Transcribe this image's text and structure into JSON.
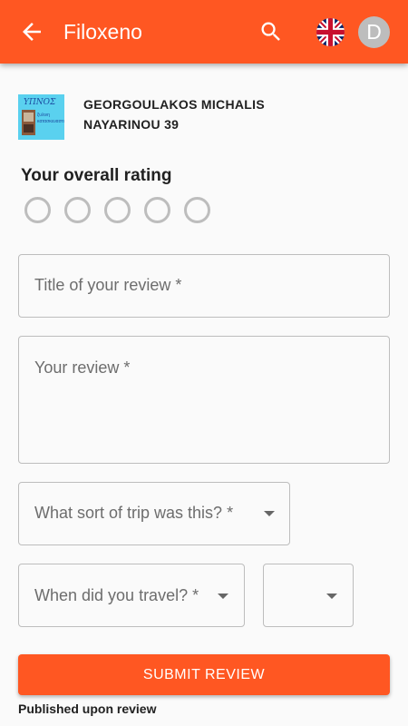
{
  "appbar": {
    "title": "Filoxeno",
    "back_icon": "arrow-back-icon",
    "search_icon": "search-icon",
    "language_icon": "uk-flag-icon",
    "avatar_initial": "D",
    "background_color": "#ff5722"
  },
  "hotel": {
    "logo_text": "ΥΠΝΟΣ",
    "logo_subtext": "ξυλινη κατασκευαστικη",
    "name": "GEORGOULAKOS MICHALIS",
    "address": "NAYARINOU 39"
  },
  "rating": {
    "label": "Your overall rating",
    "max": 5,
    "selected": 0
  },
  "form": {
    "title_placeholder": "Title of your review *",
    "review_placeholder": "Your review *",
    "trip_type_placeholder": "What sort of trip was this? *",
    "travel_date_placeholder": "When did you travel? *",
    "year_value": ""
  },
  "submit": {
    "label": "SUBMIT REVIEW",
    "note": "Published upon review",
    "color": "#ff5722"
  }
}
